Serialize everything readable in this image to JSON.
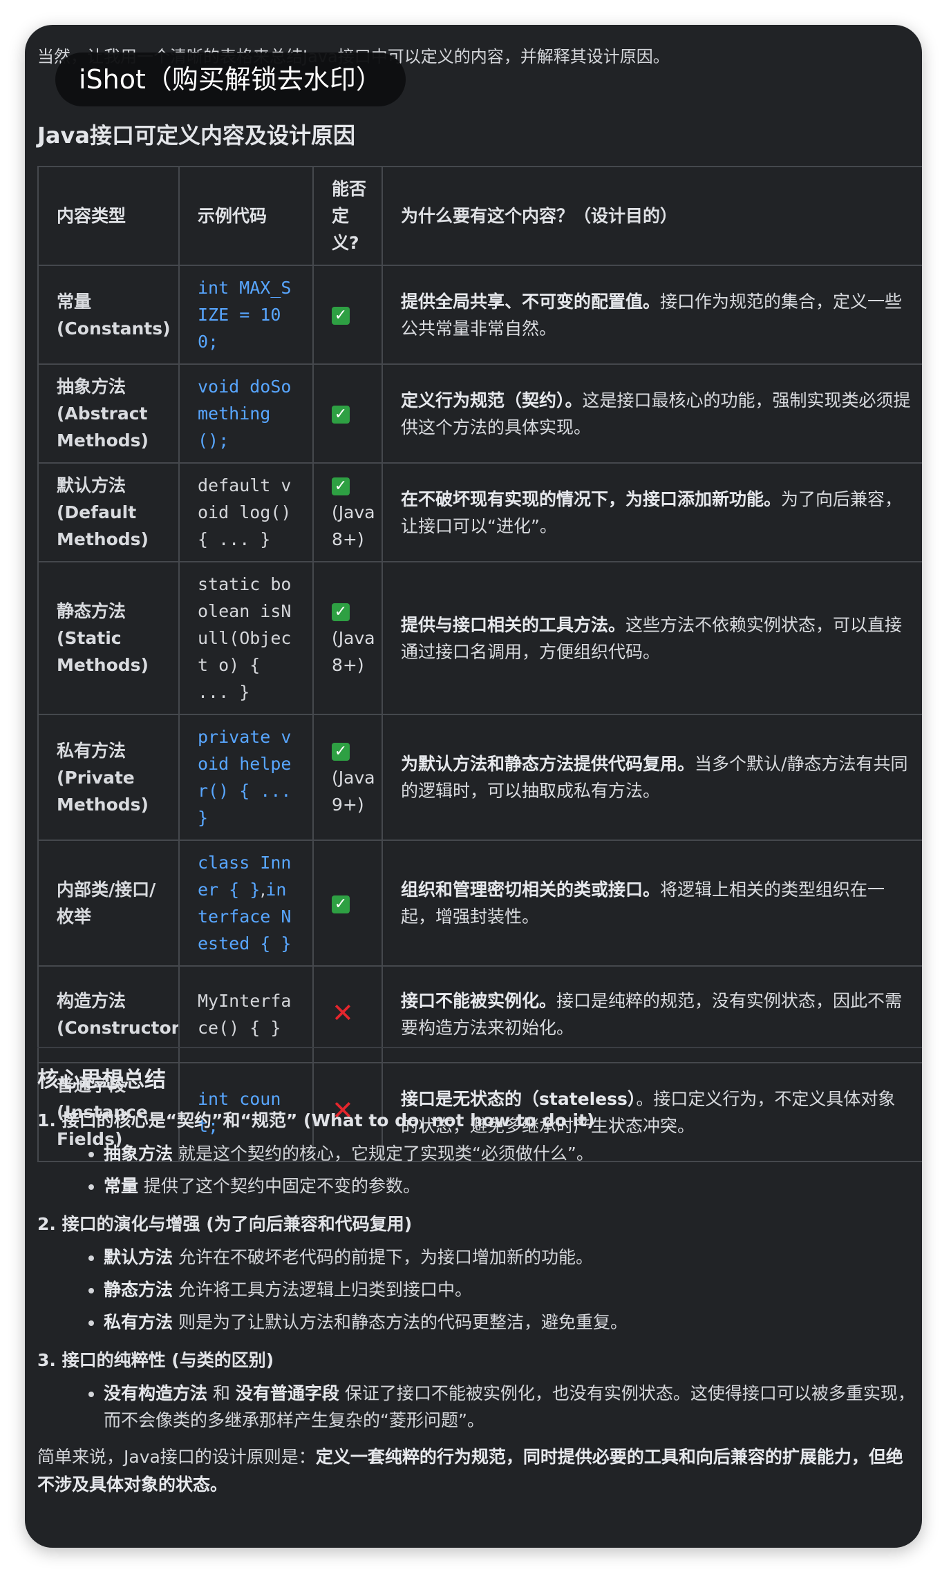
{
  "intro": "当然，让我用一个清晰的表格来总结Java接口中可以定义的内容，并解释其设计原因。",
  "watermark": "iShot（购买解锁去水印）",
  "section_title": "Java接口可定义内容及设计原因",
  "table": {
    "headers": [
      "内容类型",
      "示例代码",
      "能否定义?",
      "为什么要有这个内容？（设计目的）"
    ],
    "rows": [
      {
        "type": "常量 (Constants)",
        "code": "int MAX_SIZE = 100;",
        "code2": "",
        "code_style": "blue",
        "available": true,
        "avail_note": "",
        "desc_bold": "提供全局共享、不可变的配置值。",
        "desc": "接口作为规范的集合，定义一些公共常量非常自然。"
      },
      {
        "type": "抽象方法 (Abstract Methods)",
        "code": "void doSomething();",
        "code2": "",
        "code_style": "blue",
        "available": true,
        "avail_note": "",
        "desc_bold": "定义行为规范（契约）。",
        "desc": "这是接口最核心的功能，强制实现类必须提供这个方法的具体实现。"
      },
      {
        "type": "默认方法 (Default Methods)",
        "code": "default void log() { ... }",
        "code2": "",
        "code_style": "plain",
        "available": true,
        "avail_note": "(Java 8+)",
        "desc_bold": "在不破坏现有实现的情况下，为接口添加新功能。",
        "desc": "为了向后兼容，让接口可以“进化”。"
      },
      {
        "type": "静态方法 (Static Methods)",
        "code": "static boolean isNull(Object o) { ... }",
        "code2": "",
        "code_style": "plain",
        "available": true,
        "avail_note": "(Java 8+)",
        "desc_bold": "提供与接口相关的工具方法。",
        "desc": "这些方法不依赖实例状态，可以直接通过接口名调用，方便组织代码。"
      },
      {
        "type": "私有方法 (Private Methods)",
        "code": "private void helper() { ... }",
        "code2": "",
        "code_style": "blue",
        "available": true,
        "avail_note": "(Java 9+)",
        "desc_bold": "为默认方法和静态方法提供代码复用。",
        "desc": "当多个默认/静态方法有共同的逻辑时，可以抽取成私有方法。"
      },
      {
        "type": "内部类/接口/枚举",
        "code": "class Inner { }",
        "code_sep": ",",
        "code2": "interface Nested { }",
        "code_style": "blue",
        "available": true,
        "avail_note": "",
        "desc_bold": "组织和管理密切相关的类或接口。",
        "desc": "将逻辑上相关的类型组织在一起，增强封装性。"
      },
      {
        "type": "构造方法 (Constructors)",
        "code": "MyInterface() { }",
        "code2": "",
        "code_style": "plain",
        "available": false,
        "avail_note": "",
        "desc_bold": "接口不能被实例化。",
        "desc": "接口是纯粹的规范，没有实例状态，因此不需要构造方法来初始化。"
      },
      {
        "type": "普通字段 (Instance Fields)",
        "code": "int count;",
        "code2": "",
        "code_style": "blue",
        "available": false,
        "avail_note": "",
        "desc_bold": "接口是无状态的（stateless）",
        "desc": "。接口定义行为，不定义具体对象的状态，避免多继承时产生状态冲突。"
      }
    ]
  },
  "summary": {
    "title": "核心思想总结",
    "points": [
      {
        "heading": "1. 接口的核心是“契约”和“规范” (What to do, not how to do it)",
        "bullets": [
          {
            "bold": "抽象方法",
            "text": " 就是这个契约的核心，它规定了实现类“必须做什么”。"
          },
          {
            "bold": "常量",
            "text": " 提供了这个契约中固定不变的参数。"
          }
        ]
      },
      {
        "heading": "2. 接口的演化与增强 (为了向后兼容和代码复用)",
        "bullets": [
          {
            "bold": "默认方法",
            "text": " 允许在不破坏老代码的前提下，为接口增加新的功能。"
          },
          {
            "bold": "静态方法",
            "text": " 允许将工具方法逻辑上归类到接口中。"
          },
          {
            "bold": "私有方法",
            "text": " 则是为了让默认方法和静态方法的代码更整洁，避免重复。"
          }
        ]
      },
      {
        "heading": "3. 接口的纯粹性 (与类的区别)",
        "bullets": [
          {
            "bold": "没有构造方法",
            "text": " 和 ",
            "bold2": "没有普通字段",
            "text2": " 保证了接口不能被实例化，也没有实例状态。这使得接口可以被多重实现，而不会像类的多继承那样产生复杂的“菱形问题”。"
          }
        ]
      }
    ],
    "closing_prefix": "简单来说，Java接口的设计原则是：",
    "closing_bold": "定义一套纯粹的行为规范，同时提供必要的工具和向后兼容的扩展能力，但绝不涉及具体对象的状态。"
  },
  "icons": {
    "available": "check-mark-icon",
    "unavailable": "cross-mark-icon"
  },
  "colors": {
    "background": "#212326",
    "code_blue": "#58a6ff",
    "check_green": "#2ea043",
    "cross_red": "#e5262d"
  }
}
